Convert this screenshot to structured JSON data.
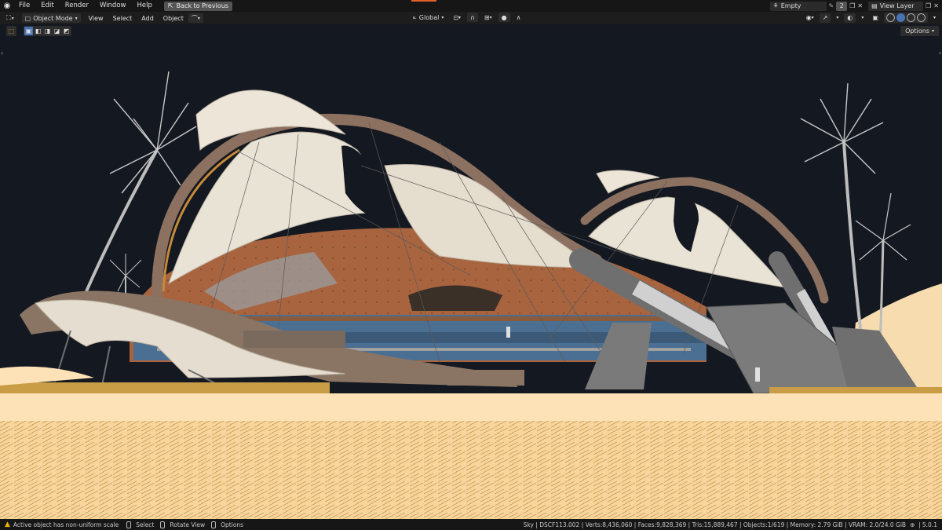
{
  "topbar": {
    "menus": [
      "File",
      "Edit",
      "Render",
      "Window",
      "Help"
    ],
    "back_button": "Back to Previous",
    "scene_name": "Empty",
    "scene_count": "2",
    "view_layer": "View Layer"
  },
  "header": {
    "mode": "Object Mode",
    "menus": [
      "View",
      "Select",
      "Add",
      "Object"
    ],
    "transform_orientation": "Global"
  },
  "viewport": {
    "options_label": "Options"
  },
  "statusbar": {
    "warning": "Active object has non-uniform scale",
    "hint_select": "Select",
    "hint_rotate": "Rotate View",
    "hint_options": "Options",
    "stats": "Sky | DSCF113.002 | Verts:8,436,060 | Faces:9,828,369 | Tris:15,889,467 | Objects:1/619 | Memory: 2.79 GiB | VRAM: 2.0/24.0 GiB",
    "version": "5.0.1"
  },
  "colors": {
    "accent": "#4772b3",
    "warning": "#e8b400",
    "sand": "#fbe0b0",
    "sky": "#141820"
  }
}
